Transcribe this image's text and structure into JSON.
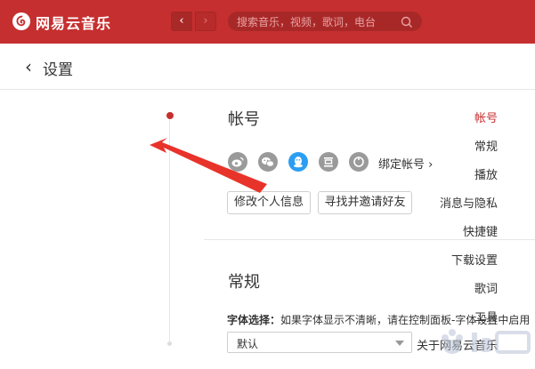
{
  "app": {
    "name": "网易云音乐",
    "logo_icon": "netease-music-logo-icon",
    "brand_color": "#c62f2f"
  },
  "toolbar": {
    "back_glyph": "‹",
    "forward_glyph": "›",
    "search_placeholder": "搜索音乐，视频，歌词，电台",
    "search_icon": "search-icon"
  },
  "header": {
    "back_glyph": "‹",
    "title": "设置"
  },
  "sidebar": {
    "items": [
      {
        "label": "帐号",
        "active": true
      },
      {
        "label": "常规"
      },
      {
        "label": "播放"
      },
      {
        "label": "消息与隐私"
      },
      {
        "label": "快捷键"
      },
      {
        "label": "下载设置"
      },
      {
        "label": "歌词"
      },
      {
        "label": "工具"
      },
      {
        "label": "关于网易云音乐"
      }
    ]
  },
  "account": {
    "title": "帐号",
    "social_icons": [
      "weibo-icon",
      "wechat-icon",
      "qq-icon",
      "douban-icon",
      "netease-icon"
    ],
    "bind_link": "绑定帐号 ›",
    "edit_button": "修改个人信息",
    "invite_button": "寻找并邀请好友"
  },
  "general": {
    "title": "常规",
    "font_label_bold": "字体选择：",
    "font_hint": "如果字体显示不清晰，请在控制面板-字体设置中启用",
    "font_value": "默认"
  }
}
